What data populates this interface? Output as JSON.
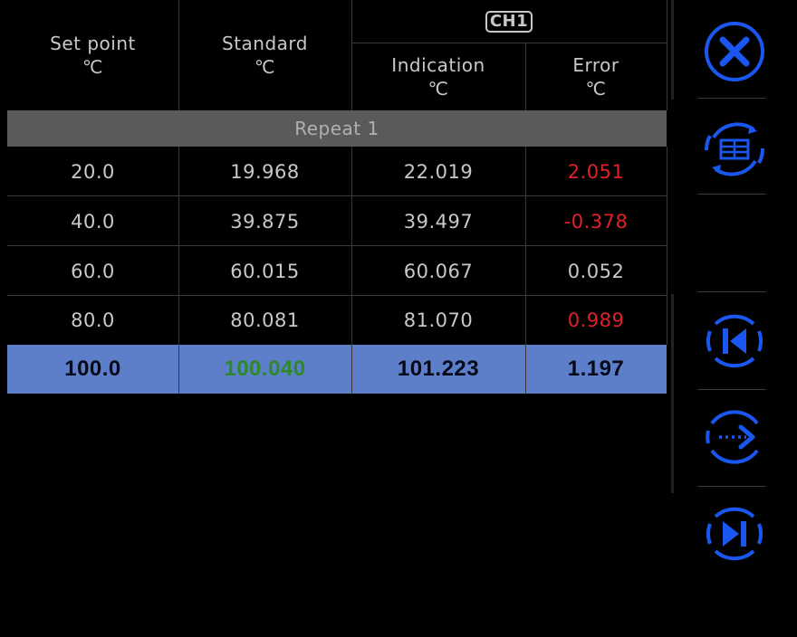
{
  "table": {
    "headers": {
      "set_point": "Set point",
      "set_point_unit": "℃",
      "standard": "Standard",
      "standard_unit": "℃",
      "channel": "CH1",
      "indication": "Indication",
      "indication_unit": "℃",
      "error": "Error",
      "error_unit": "℃"
    },
    "repeat_label": "Repeat 1",
    "rows": [
      {
        "set_point": "20.0",
        "standard": "19.968",
        "indication": "22.019",
        "error": "2.051"
      },
      {
        "set_point": "40.0",
        "standard": "39.875",
        "indication": "39.497",
        "error": "-0.378"
      },
      {
        "set_point": "60.0",
        "standard": "60.015",
        "indication": "60.067",
        "error": "0.052"
      },
      {
        "set_point": "80.0",
        "standard": "80.081",
        "indication": "81.070",
        "error": "0.989"
      },
      {
        "set_point": "100.0",
        "standard": "100.040",
        "indication": "101.223",
        "error": "1.197"
      }
    ]
  },
  "sidebar": {
    "buttons": [
      {
        "icon": "close-icon"
      },
      {
        "icon": "table-refresh-icon"
      },
      {
        "icon": "skip-first-icon"
      },
      {
        "icon": "next-dotted-arrow-icon"
      },
      {
        "icon": "skip-last-icon"
      }
    ]
  },
  "colors": {
    "background": "#000000",
    "accent_blue": "#1a56f0",
    "highlight_row": "#5d7ec9",
    "error_red": "#e0202a",
    "standard_green": "#2c8a2a"
  }
}
